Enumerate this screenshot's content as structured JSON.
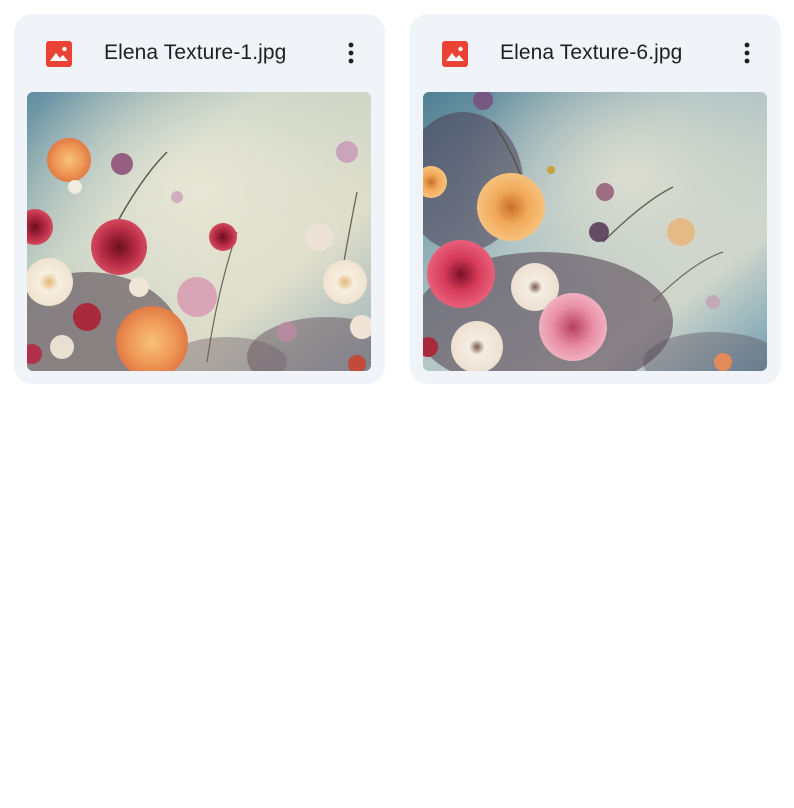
{
  "files": [
    {
      "name": "Elena Texture-1.jpg",
      "type_icon": "image-icon",
      "menu_icon": "more-vert-icon",
      "thumbnail": "floral painting with peach, crimson and cream flowers on a misty blue background"
    },
    {
      "name": "Elena Texture-6.jpg",
      "type_icon": "image-icon",
      "menu_icon": "more-vert-icon",
      "thumbnail": "floral painting with orange, pink and white flowers on a teal blue background"
    }
  ],
  "colors": {
    "card_bg": "#f0f4f9",
    "image_icon_red": "#ea4335",
    "text": "#1f1f1f"
  }
}
